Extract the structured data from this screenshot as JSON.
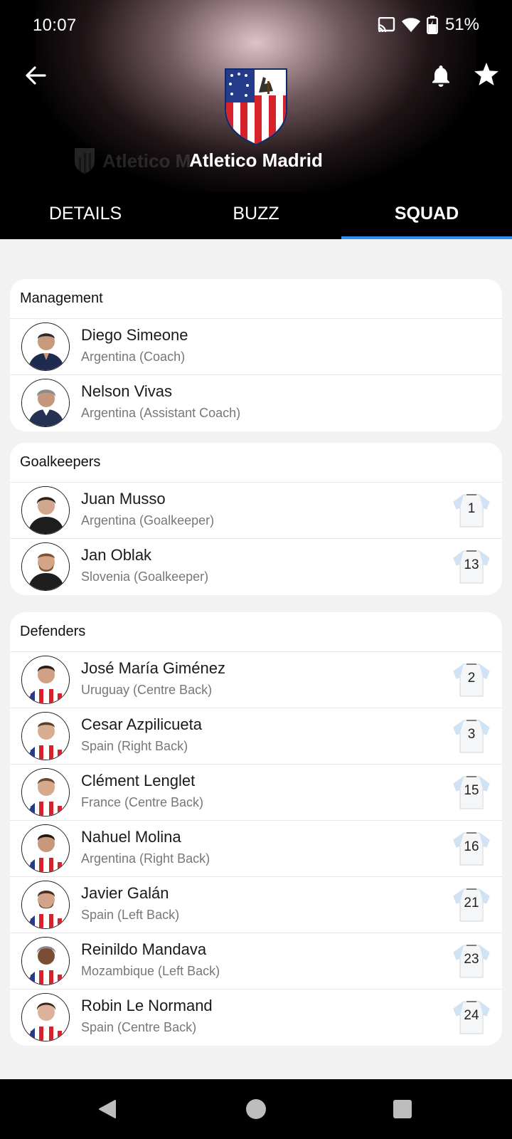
{
  "status_bar": {
    "time": "10:07",
    "battery": "51%"
  },
  "header": {
    "team_name": "Atletico Madrid",
    "ghost_title": "Atletico M",
    "back_icon": "arrow-left-icon",
    "bell_icon": "bell-icon",
    "star_icon": "star-icon"
  },
  "tabs": [
    {
      "label": "DETAILS",
      "active": false
    },
    {
      "label": "BUZZ",
      "active": false
    },
    {
      "label": "SQUAD",
      "active": true
    }
  ],
  "colors": {
    "accent": "#2f8ff0",
    "background": "#f2f2f2",
    "card": "#ffffff"
  },
  "sections": [
    {
      "title": "Management",
      "people": [
        {
          "name": "Diego Simeone",
          "info": "Argentina (Coach)",
          "number": ""
        },
        {
          "name": "Nelson Vivas",
          "info": "Argentina (Assistant Coach)",
          "number": ""
        }
      ]
    },
    {
      "title": "Goalkeepers",
      "people": [
        {
          "name": "Juan Musso",
          "info": "Argentina (Goalkeeper)",
          "number": "1"
        },
        {
          "name": "Jan Oblak",
          "info": "Slovenia (Goalkeeper)",
          "number": "13"
        }
      ]
    },
    {
      "title": "Defenders",
      "people": [
        {
          "name": "José María Giménez",
          "info": "Uruguay (Centre Back)",
          "number": "2"
        },
        {
          "name": "Cesar Azpilicueta",
          "info": "Spain (Right Back)",
          "number": "3"
        },
        {
          "name": "Clément Lenglet",
          "info": "France (Centre Back)",
          "number": "15"
        },
        {
          "name": "Nahuel Molina",
          "info": "Argentina (Right Back)",
          "number": "16"
        },
        {
          "name": "Javier Galán",
          "info": "Spain (Left Back)",
          "number": "21"
        },
        {
          "name": "Reinildo Mandava",
          "info": "Mozambique (Left Back)",
          "number": "23"
        },
        {
          "name": "Robin Le Normand",
          "info": "Spain (Centre Back)",
          "number": "24"
        }
      ]
    }
  ]
}
